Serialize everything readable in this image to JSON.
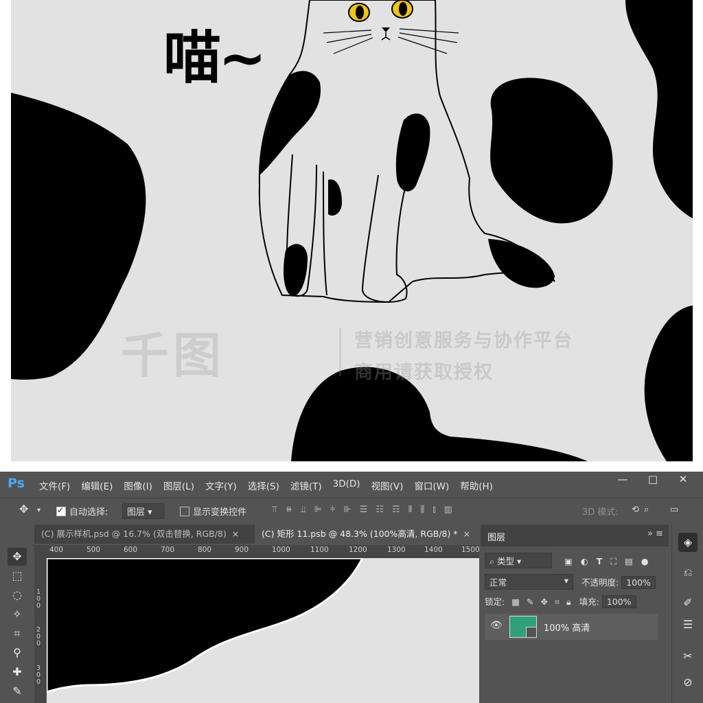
{
  "artwork": {
    "meow_text": "喵~",
    "watermark_logo": "千图",
    "watermark_line1": "营销创意服务与协作平台",
    "watermark_line2": "商用请获取授权",
    "colors": {
      "background": "#e2e2e2",
      "spots": "#000000",
      "cat_eyes": "#f2c318"
    }
  },
  "app": {
    "logo": "Ps",
    "menu": [
      "文件(F)",
      "编辑(E)",
      "图像(I)",
      "图层(L)",
      "文字(Y)",
      "选择(S)",
      "滤镜(T)",
      "3D(D)",
      "视图(V)",
      "窗口(W)",
      "帮助(H)"
    ],
    "window_controls": {
      "minimize": "—",
      "maximize": "□",
      "close": "✕"
    }
  },
  "options": {
    "auto_select_label": "自动选择:",
    "auto_select_checked": true,
    "auto_select_value": "图层",
    "show_transform_label": "显示变换控件",
    "show_transform_checked": false,
    "mode_3d_label": "3D 模式:"
  },
  "tabs": [
    {
      "label": "(C) 展示样机.psd @ 16.7% (双击替换, RGB/8)",
      "close": "×",
      "active": false
    },
    {
      "label": "(C) 矩形 11.psb @ 48.3% (100%高清, RGB/8) *",
      "close": "×",
      "active": true
    }
  ],
  "ruler_h": [
    "400",
    "500",
    "600",
    "700",
    "800",
    "900",
    "1000",
    "1100",
    "1200",
    "1300",
    "1400",
    "1500"
  ],
  "ruler_v": [
    "100",
    "200",
    "300"
  ],
  "layers_panel": {
    "title": "图层",
    "filter_label": "类型",
    "blend_mode": "正常",
    "opacity_label": "不透明度:",
    "opacity_value": "100%",
    "lock_label": "锁定:",
    "fill_label": "填充:",
    "fill_value": "100%",
    "layers": [
      {
        "name": "100% 高清",
        "visible": true,
        "thumb_color": "#2fa07a"
      }
    ]
  }
}
